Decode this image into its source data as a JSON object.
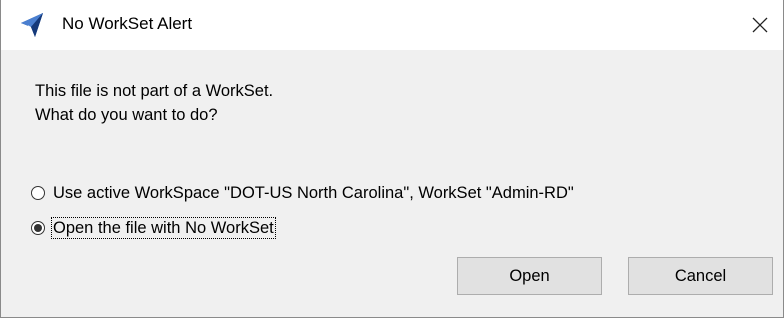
{
  "window": {
    "title": "No WorkSet Alert",
    "icon": "app-logo-icon",
    "close_glyph": "×"
  },
  "message": {
    "line1": "This file is not part of a WorkSet.",
    "line2": "What do you want to do?"
  },
  "options": [
    {
      "label": "Use active WorkSpace \"DOT-US North Carolina\", WorkSet \"Admin-RD\"",
      "selected": false
    },
    {
      "label": "Open the file with No WorkSet",
      "selected": true
    }
  ],
  "buttons": {
    "open_label": "Open",
    "cancel_label": "Cancel"
  },
  "colors": {
    "dialog_background": "#f0f0f0",
    "titlebar_background": "#ffffff",
    "button_background": "#e1e1e1",
    "button_border": "#adadad",
    "icon_blue": "#1e4f9c"
  }
}
